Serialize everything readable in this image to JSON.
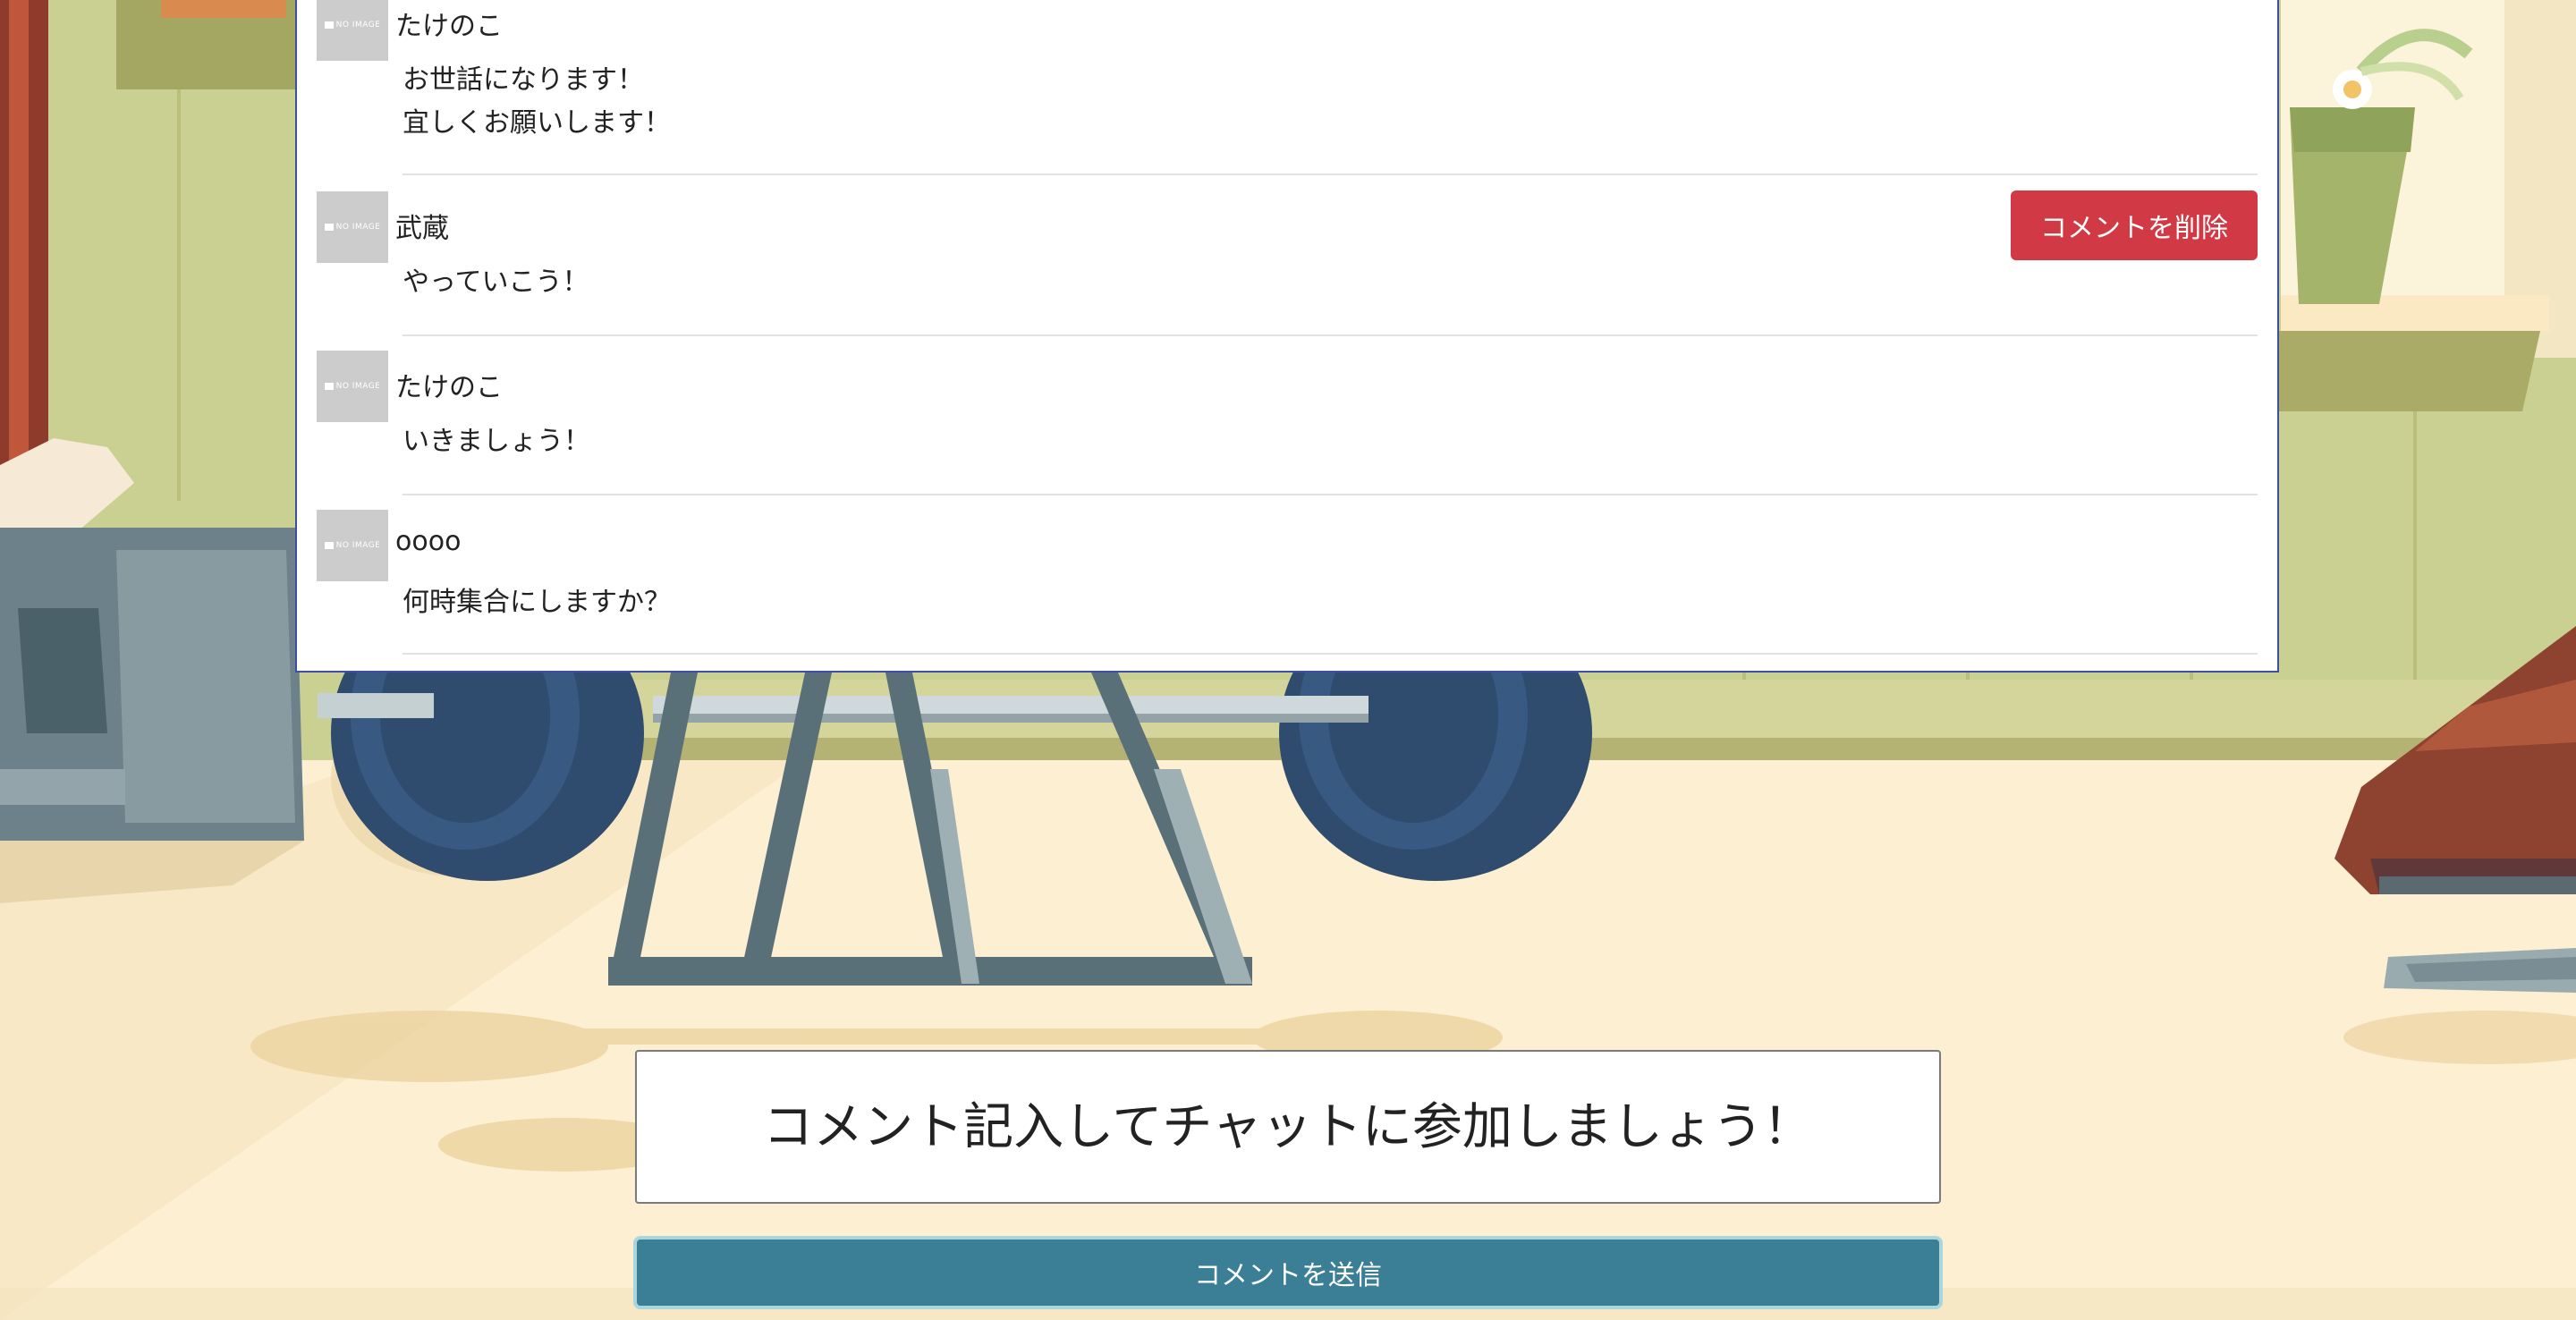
{
  "chat": {
    "avatar_placeholder": "NO IMAGE",
    "messages": [
      {
        "user": "たけのこ",
        "lines": [
          "お世話になります！",
          "宜しくお願いします！"
        ]
      },
      {
        "user": "武蔵",
        "lines": [
          "やっていこう！"
        ],
        "delete_label": "コメントを削除"
      },
      {
        "user": "たけのこ",
        "lines": [
          "いきましょう！"
        ]
      },
      {
        "user": "oooo",
        "lines": [
          "何時集合にしますか？"
        ]
      }
    ]
  },
  "form": {
    "placeholder": "コメント記入してチャットに参加しましょう！",
    "value": "",
    "send_label": "コメントを送信"
  },
  "colors": {
    "delete_button": "#d13a45",
    "send_button": "#3b7f96",
    "panel_border": "#3d4fa0"
  }
}
